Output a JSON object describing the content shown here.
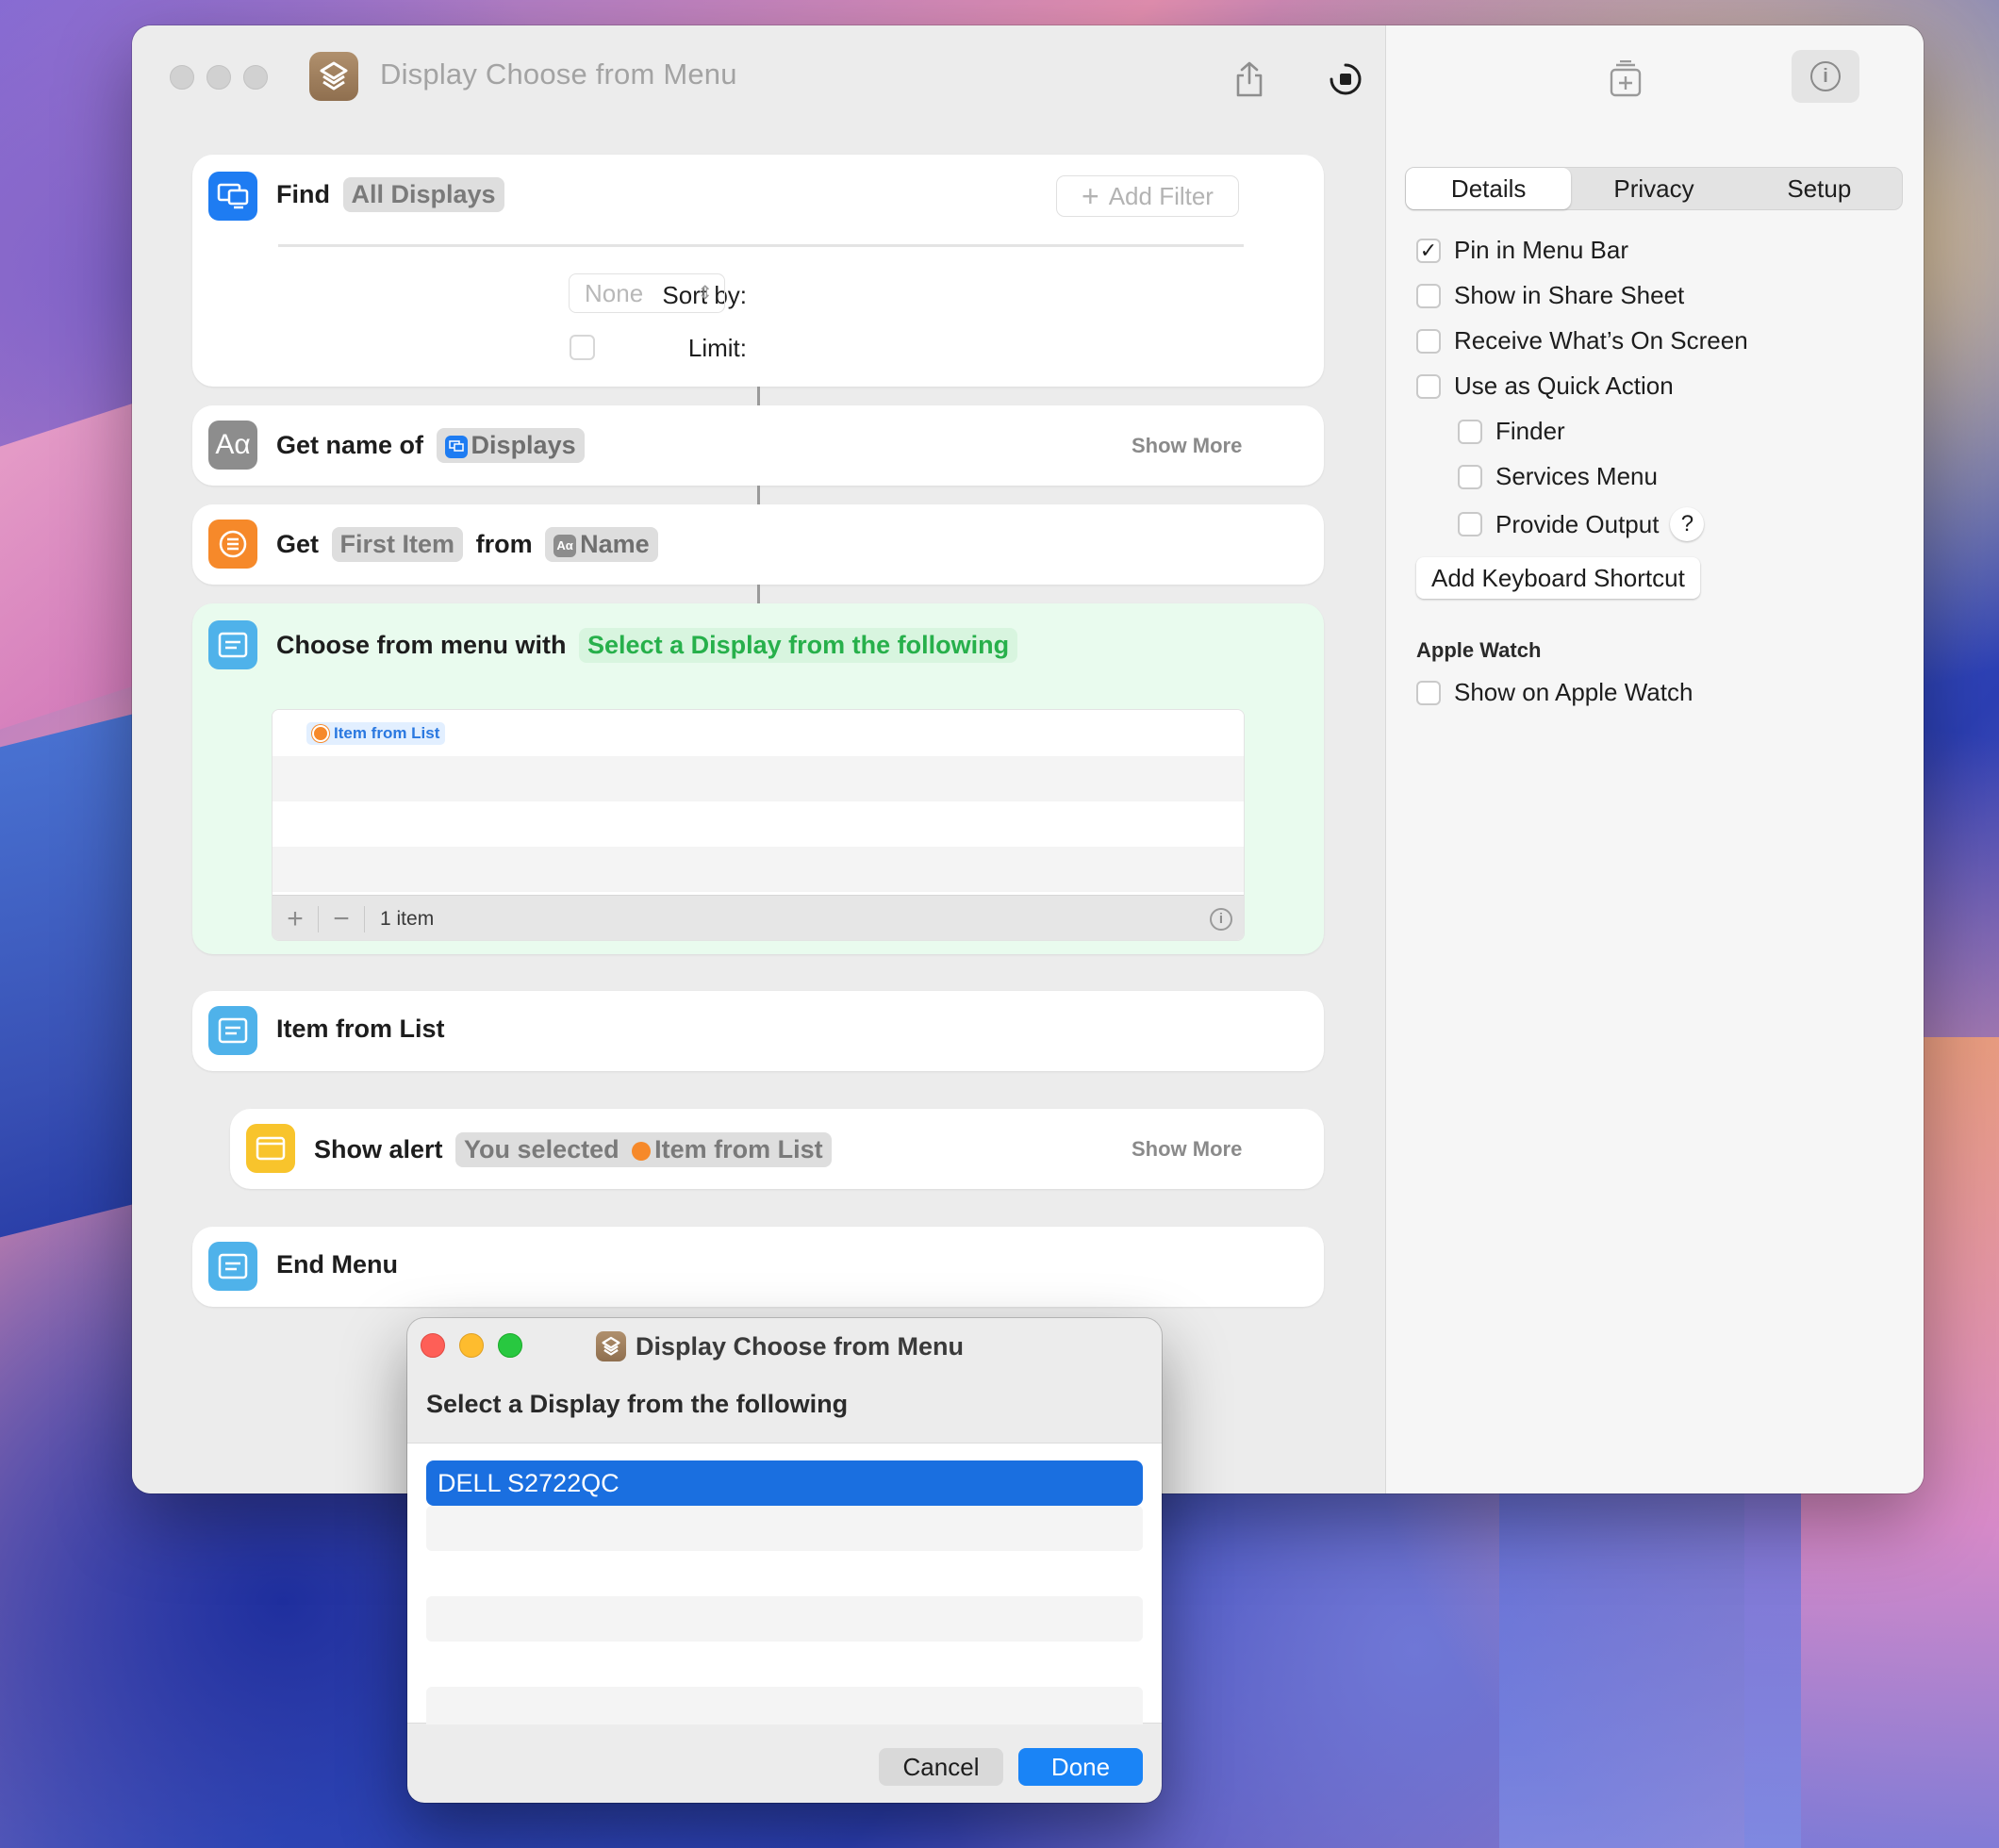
{
  "window": {
    "title": "Display Choose from Menu"
  },
  "actions": {
    "find": {
      "verb": "Find",
      "token": "All Displays",
      "add_filter": "Add Filter",
      "sort_label": "Sort by:",
      "sort_value": "None",
      "limit_label": "Limit:"
    },
    "get_name": {
      "verb": "Get name of",
      "token": "Displays",
      "show_more": "Show More"
    },
    "get_item": {
      "verb": "Get",
      "token": "First Item",
      "from": "from",
      "source": "Name"
    },
    "choose_menu": {
      "verb": "Choose from menu with",
      "prompt": "Select a Display from the following",
      "list_item": "Item from List",
      "item_count": "1 item"
    },
    "item_from_list": {
      "label": "Item from List"
    },
    "show_alert": {
      "verb": "Show alert",
      "text": "You selected",
      "variable": "Item from List",
      "show_more": "Show More"
    },
    "end_menu": {
      "label": "End Menu"
    }
  },
  "inspector": {
    "tabs": [
      "Details",
      "Privacy",
      "Setup"
    ],
    "options": {
      "pin_menu_bar": "Pin in Menu Bar",
      "share_sheet": "Show in Share Sheet",
      "receive_screen": "Receive What’s On Screen",
      "quick_action": "Use as Quick Action",
      "finder": "Finder",
      "services_menu": "Services Menu",
      "provide_output": "Provide Output"
    },
    "help": "?",
    "add_shortcut": "Add Keyboard Shortcut",
    "apple_watch_heading": "Apple Watch",
    "show_apple_watch": "Show on Apple Watch"
  },
  "dialog": {
    "title": "Display Choose from Menu",
    "prompt": "Select a Display from the following",
    "selected_item": "DELL S2722QC",
    "cancel": "Cancel",
    "done": "Done"
  },
  "colors": {
    "accent_blue": "#1a6fe0",
    "menu_green": "#27b04b"
  }
}
